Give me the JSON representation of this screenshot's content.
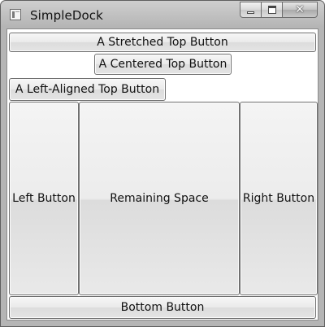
{
  "window": {
    "title": "SimpleDock"
  },
  "caption_buttons": {
    "minimize": "minimize",
    "maximize": "maximize",
    "close": "✕"
  },
  "buttons": {
    "stretched_top": "A Stretched Top Button",
    "centered_top": "A Centered Top Button",
    "left_aligned_top": "A Left-Aligned Top Button",
    "left": "Left Button",
    "remaining": "Remaining Space",
    "right": "Right Button",
    "bottom": "Bottom Button"
  },
  "icons": {
    "app": "window-app-icon",
    "minimize": "minimize-icon",
    "maximize": "maximize-icon",
    "close": "close-icon"
  }
}
